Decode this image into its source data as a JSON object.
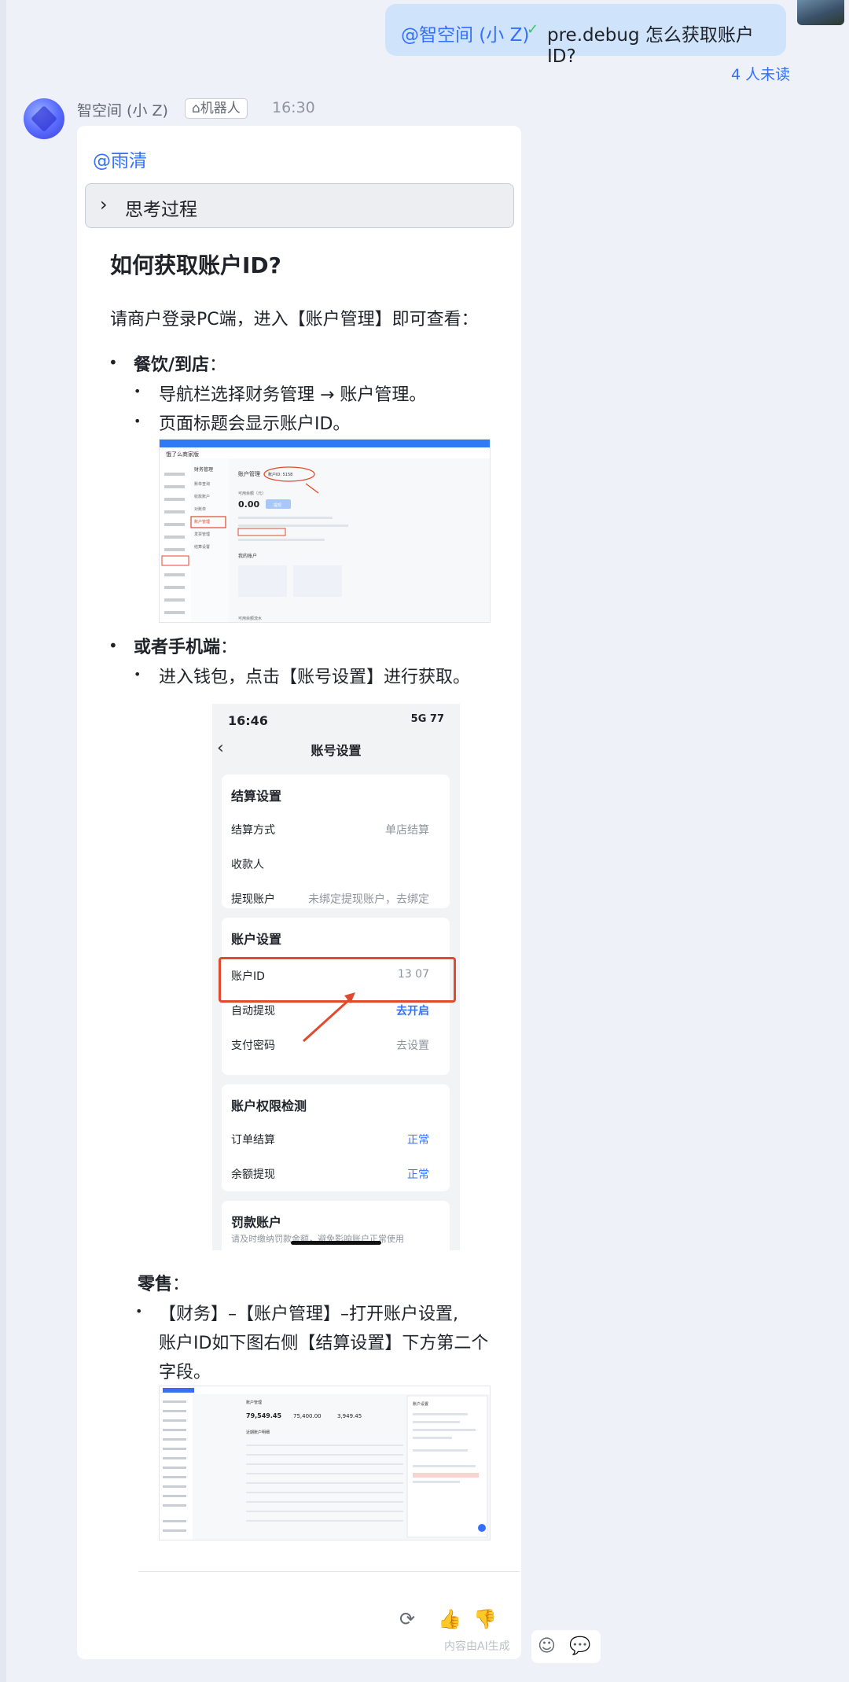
{
  "user_message": {
    "mention": "@智空间 (小 Z)",
    "text": "pre.debug 怎么获取账户 ID?"
  },
  "unread_label": "4 人未读",
  "bot": {
    "name": "智空间 (小 Z)",
    "tag": "机器人",
    "time": "16:30"
  },
  "reply": {
    "mention": "@雨清",
    "thinking_label": "思考过程",
    "heading": "如何获取账户ID?",
    "intro": "请商户登录PC端，进入【账户管理】即可查看：",
    "section1": {
      "title": "餐饮/到店",
      "colon": "：",
      "items": [
        "导航栏选择财务管理 → 账户管理。",
        "页面标题会显示账户ID。"
      ]
    },
    "section2": {
      "title": "或者手机端",
      "colon": "：",
      "items": [
        "进入钱包，点击【账号设置】进行获取。"
      ]
    },
    "section3": {
      "title": "零售",
      "colon": "：",
      "item_lines": [
        "【财务】–【账户管理】–打开账户设置,",
        "账户ID如下图右侧【结算设置】下方第二个",
        "字段。"
      ]
    },
    "ai_note": "内容由AI生成"
  },
  "pc_screenshot": {
    "app_name": "饿了么商家版",
    "menu_header": "财务管理",
    "page_title": "账户管理",
    "account_id_label": "账户ID: 5158",
    "balance_label": "可用余额（元）",
    "balance": "0.00",
    "withdraw_btn": "提现",
    "menu_items": [
      "账单查询",
      "收款账户",
      "对账单",
      "账户管理",
      "发票管理",
      "结算设置"
    ],
    "my_accounts": "我的账户",
    "flow_label": "可用余额流水"
  },
  "phone_screenshot": {
    "time": "16:46",
    "status": "5G 77",
    "nav_title": "账号设置",
    "settle": {
      "title": "结算设置",
      "rows": [
        {
          "label": "结算方式",
          "value": "单店结算"
        },
        {
          "label": "收款人",
          "value": ""
        },
        {
          "label": "提现账户",
          "value": "未绑定提现账户，去绑定"
        }
      ]
    },
    "account": {
      "title": "账户设置",
      "rows": [
        {
          "label": "账户ID",
          "value": "13        07"
        },
        {
          "label": "自动提现",
          "value": "去开启"
        },
        {
          "label": "支付密码",
          "value": "去设置"
        }
      ]
    },
    "perm": {
      "title": "账户权限检测",
      "rows": [
        {
          "label": "订单结算",
          "value": "正常"
        },
        {
          "label": "余额提现",
          "value": "正常"
        }
      ]
    },
    "penalty": {
      "title": "罚款账户",
      "note": "请及时缴纳罚款金额，避免影响账户正常使用"
    }
  },
  "retail_screenshot": {
    "section": "账户管理",
    "stats": [
      "79,549.45",
      "75,400.00",
      "3,949.45"
    ],
    "panel_title": "账户设置",
    "table_title": "近期账户明细"
  },
  "icons": {
    "refresh": "refresh-icon",
    "thumb_up": "thumbs-up-icon",
    "thumb_down": "thumbs-down-icon",
    "add_reaction": "add-reaction-icon",
    "comment": "comment-icon"
  }
}
